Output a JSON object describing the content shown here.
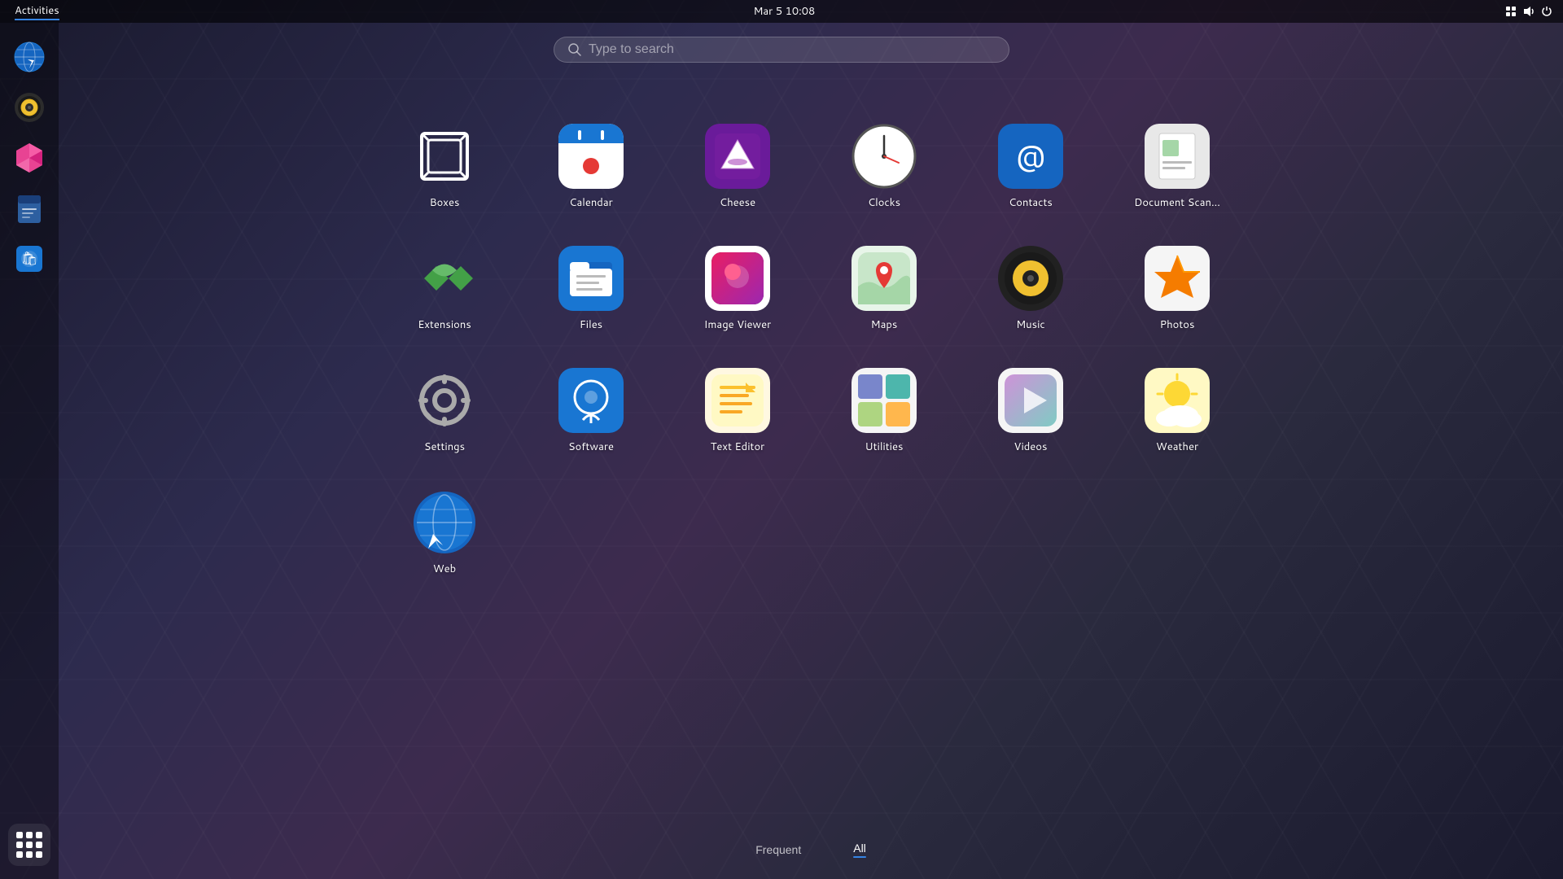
{
  "topbar": {
    "activities_label": "Activities",
    "datetime": "Mar 5  10:08"
  },
  "search": {
    "placeholder": "Type to search"
  },
  "tabs": [
    {
      "id": "frequent",
      "label": "Frequent",
      "active": false
    },
    {
      "id": "all",
      "label": "All",
      "active": true
    }
  ],
  "apps": [
    {
      "id": "boxes",
      "label": "Boxes",
      "icon": "boxes"
    },
    {
      "id": "calendar",
      "label": "Calendar",
      "icon": "calendar"
    },
    {
      "id": "cheese",
      "label": "Cheese",
      "icon": "cheese"
    },
    {
      "id": "clocks",
      "label": "Clocks",
      "icon": "clocks"
    },
    {
      "id": "contacts",
      "label": "Contacts",
      "icon": "contacts"
    },
    {
      "id": "docscan",
      "label": "Document Scan...",
      "icon": "docscan"
    },
    {
      "id": "extensions",
      "label": "Extensions",
      "icon": "extensions"
    },
    {
      "id": "files",
      "label": "Files",
      "icon": "files"
    },
    {
      "id": "imageviewer",
      "label": "Image Viewer",
      "icon": "imageviewer"
    },
    {
      "id": "maps",
      "label": "Maps",
      "icon": "maps"
    },
    {
      "id": "music",
      "label": "Music",
      "icon": "music"
    },
    {
      "id": "photos",
      "label": "Photos",
      "icon": "photos"
    },
    {
      "id": "settings",
      "label": "Settings",
      "icon": "settings"
    },
    {
      "id": "software",
      "label": "Software",
      "icon": "software"
    },
    {
      "id": "texteditor",
      "label": "Text Editor",
      "icon": "texteditor"
    },
    {
      "id": "utilities",
      "label": "Utilities",
      "icon": "utilities"
    },
    {
      "id": "videos",
      "label": "Videos",
      "icon": "videos"
    },
    {
      "id": "weather",
      "label": "Weather",
      "icon": "weather"
    },
    {
      "id": "web",
      "label": "Web",
      "icon": "web"
    }
  ],
  "sidebar": {
    "items": [
      {
        "id": "web-browser",
        "label": "Web Browser"
      },
      {
        "id": "speaker",
        "label": "Speaker"
      },
      {
        "id": "prism",
        "label": "Prism"
      },
      {
        "id": "notes",
        "label": "Notes"
      },
      {
        "id": "store",
        "label": "Store"
      }
    ]
  }
}
